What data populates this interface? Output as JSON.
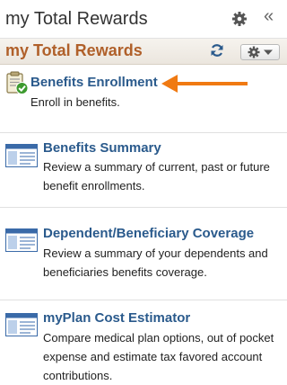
{
  "window": {
    "title": "my Total Rewards"
  },
  "pagelet": {
    "title": "my Total Rewards",
    "title_color": "#b0602a"
  },
  "colors": {
    "link": "#2a5a8c",
    "arrow": "#f07a12"
  },
  "items": [
    {
      "icon": "clipboard-check-icon",
      "title": "Benefits Enrollment",
      "description": "Enroll in benefits."
    },
    {
      "icon": "window-summary-icon",
      "title": "Benefits Summary",
      "description": "Review a summary of current, past or future benefit enrollments."
    },
    {
      "icon": "window-summary-icon",
      "title": "Dependent/Beneficiary Coverage",
      "description": "Review a summary of your dependents and beneficiaries benefits coverage."
    },
    {
      "icon": "window-summary-icon",
      "title": "myPlan Cost Estimator",
      "description": "Compare medical plan options, out of pocket expense and estimate tax favored account contributions."
    }
  ]
}
